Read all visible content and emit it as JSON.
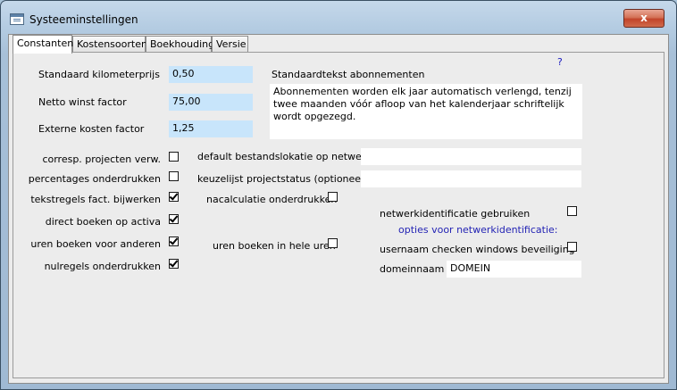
{
  "window": {
    "title": "Systeeminstellingen",
    "close_glyph": "x"
  },
  "tabs": [
    "Constanten",
    "Kostensoorten",
    "Boekhouding",
    "Versie"
  ],
  "help_glyph": "?",
  "constants": {
    "km_label": "Standaard kilometerprijs",
    "km_value": "0,50",
    "profit_label": "Netto winst factor",
    "profit_value": "75,00",
    "extcost_label": "Externe kosten factor",
    "extcost_value": "1,25"
  },
  "abonnement": {
    "label": "Standaardtekst abonnementen",
    "text": "Abonnementen worden elk jaar automatisch verlengd, tenzij twee maanden vóór afloop van het kalenderjaar schriftelijk wordt opgezegd."
  },
  "options_left": [
    {
      "label": "corresp. projecten verw.",
      "checked": false
    },
    {
      "label": "percentages onderdrukken",
      "checked": false
    },
    {
      "label": "tekstregels fact. bijwerken",
      "checked": true
    },
    {
      "label": "direct boeken op activa",
      "checked": true
    },
    {
      "label": "uren boeken voor anderen",
      "checked": true
    },
    {
      "label": "nulregels onderdrukken",
      "checked": true
    }
  ],
  "middle": {
    "default_location_label": "default bestandslokatie op netwerk",
    "default_location_value": "",
    "project_status_label": "keuzelijst projectstatus (optioneel)",
    "project_status_value": "",
    "nacalculatie_label": "nacalculatie onderdrukken",
    "nacalculatie_checked": false,
    "hele_uren_label": "uren boeken in hele uren",
    "hele_uren_checked": false
  },
  "network": {
    "use_label": "netwerkidentificatie gebruiken",
    "use_checked": false,
    "options_heading": "opties voor netwerkidentificatie:",
    "check_windows_label": "usernaam checken windows beveiliging",
    "check_windows_checked": false,
    "domain_label": "domeinnaam",
    "domain_value": "DOMEIN"
  }
}
